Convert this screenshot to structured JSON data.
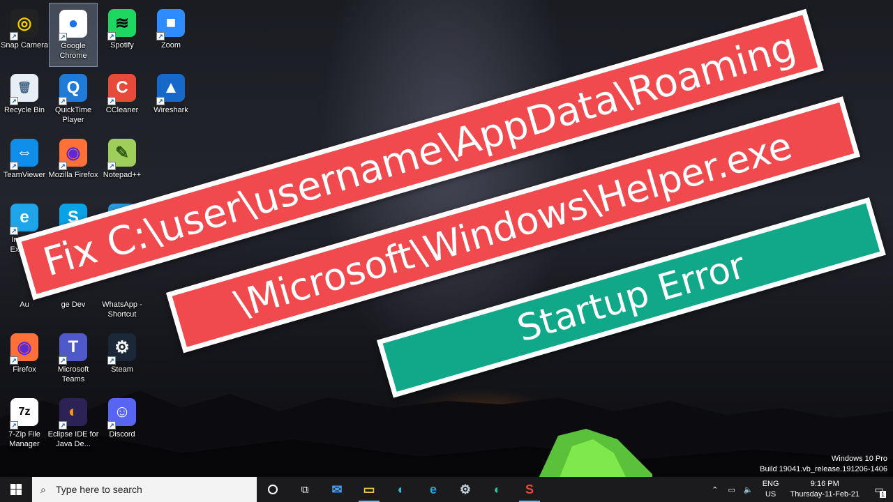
{
  "desktop": {
    "icons": [
      {
        "label": "Snap Camera",
        "glyph": "◎",
        "bg": "#222222",
        "fg": "#f5d000"
      },
      {
        "label": "Google Chrome",
        "glyph": "●",
        "bg": "#ffffff",
        "fg": "#1a73e8"
      },
      {
        "label": "Spotify",
        "glyph": "≋",
        "bg": "#1ed760",
        "fg": "#000000"
      },
      {
        "label": "Zoom",
        "glyph": "■",
        "bg": "#2d8cff",
        "fg": "#ffffff"
      },
      {
        "label": "Recycle Bin",
        "glyph": "🗑",
        "bg": "#e8eef5",
        "fg": "#4a6a8a"
      },
      {
        "label": "QuickTime Player",
        "glyph": "Q",
        "bg": "#1f7ad8",
        "fg": "#ffffff"
      },
      {
        "label": "CCleaner",
        "glyph": "C",
        "bg": "#e84a3a",
        "fg": "#ffffff"
      },
      {
        "label": "Wireshark",
        "glyph": "▲",
        "bg": "#1668c9",
        "fg": "#ffffff"
      },
      {
        "label": "TeamViewer",
        "glyph": "⇔",
        "bg": "#0e8ee9",
        "fg": "#ffffff"
      },
      {
        "label": "Mozilla Firefox",
        "glyph": "◉",
        "bg": "#ff7139",
        "fg": "#5b2ad6"
      },
      {
        "label": "Notepad++",
        "glyph": "✎",
        "bg": "#9fcf5a",
        "fg": "#2e5b14"
      },
      {
        "label": "Internet Explorer",
        "glyph": "e",
        "bg": "#1ea4e9",
        "fg": "#ffffff"
      },
      {
        "label": "",
        "glyph": "S",
        "bg": "#0aa2e6",
        "fg": "#ffffff"
      },
      {
        "label": "",
        "glyph": "◐",
        "bg": "#2b9be0",
        "fg": "#7fe0a0"
      },
      {
        "label": "Au",
        "glyph": "",
        "bg": "#1e3fa8",
        "fg": "#ffffff"
      },
      {
        "label": "ge Dev",
        "glyph": "",
        "bg": "transparent",
        "fg": "#ffffff"
      },
      {
        "label": "WhatsApp - Shortcut",
        "glyph": "",
        "bg": "transparent",
        "fg": "#ffffff"
      },
      {
        "label": "Firefox",
        "glyph": "◉",
        "bg": "#ff7139",
        "fg": "#5b2ad6"
      },
      {
        "label": "Microsoft Teams",
        "glyph": "T",
        "bg": "#5059c9",
        "fg": "#ffffff"
      },
      {
        "label": "Steam",
        "glyph": "⚙",
        "bg": "#1b2838",
        "fg": "#ffffff"
      },
      {
        "label": "7-Zip File Manager",
        "glyph": "7z",
        "bg": "#ffffff",
        "fg": "#000000"
      },
      {
        "label": "Eclipse IDE for Java De...",
        "glyph": "◐",
        "bg": "#2c2255",
        "fg": "#f7941e"
      },
      {
        "label": "Discord",
        "glyph": "☺",
        "bg": "#5865f2",
        "fg": "#ffffff"
      }
    ]
  },
  "banners": {
    "line1": "Fix C:\\user\\username\\AppData\\Roaming",
    "line2": "\\Microsoft\\Windows\\Helper.exe",
    "line3": "Startup Error",
    "red": "#f04a4f",
    "green": "#11a889"
  },
  "watermark": {
    "edition": "Windows 10 Pro",
    "build": "Build 19041.vb_release.191206-1406"
  },
  "taskbar": {
    "search_placeholder": "Type here to search",
    "apps": [
      {
        "name": "mail-icon",
        "glyph": "✉",
        "color": "#4aa3ff"
      },
      {
        "name": "file-explorer-icon",
        "glyph": "▭",
        "color": "#f5c342"
      },
      {
        "name": "edge-icon",
        "glyph": "◐",
        "color": "#37b5e6"
      },
      {
        "name": "internet-explorer-icon",
        "glyph": "e",
        "color": "#1ea4e9"
      },
      {
        "name": "steam-icon",
        "glyph": "⚙",
        "color": "#c7d5e0"
      },
      {
        "name": "edge-dev-icon",
        "glyph": "◐",
        "color": "#2fbf9a"
      },
      {
        "name": "snagit-icon",
        "glyph": "S",
        "color": "#e84a3a"
      }
    ],
    "lang_top": "ENG",
    "lang_bottom": "US",
    "time": "9:16 PM",
    "date": "Thursday-11-Feb-21",
    "notification_count": "1",
    "accent": "#76b9ed"
  }
}
